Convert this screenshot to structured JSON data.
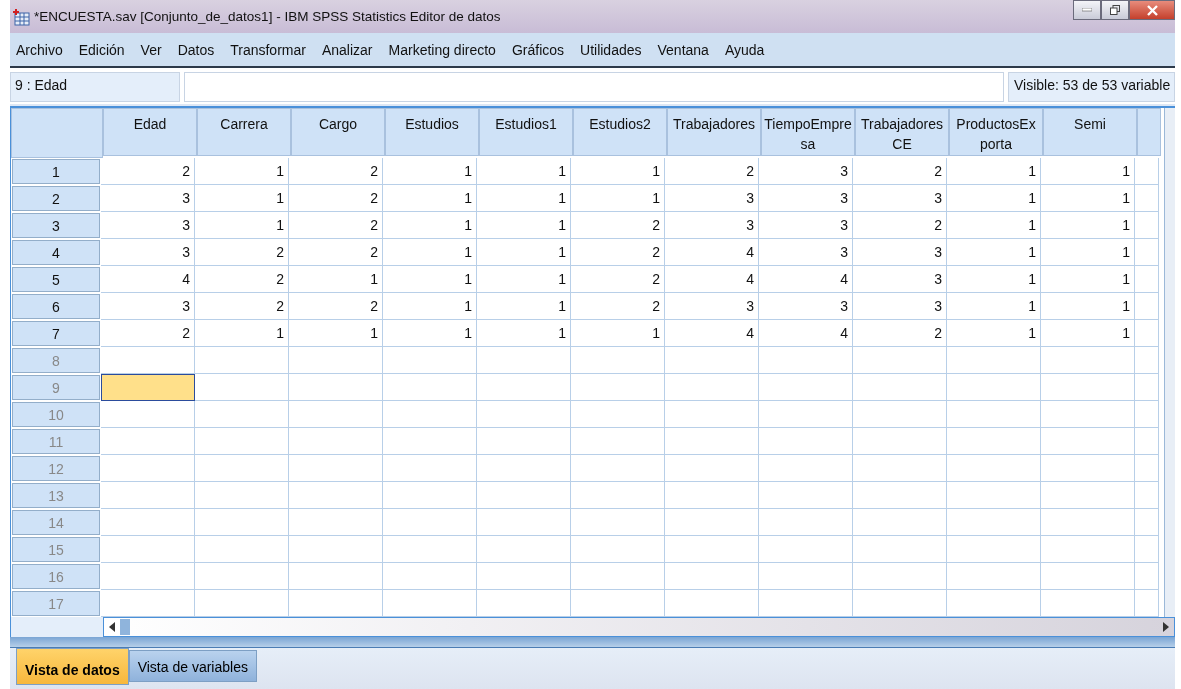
{
  "window": {
    "title": "*ENCUESTA.sav [Conjunto_de_datos1] - IBM SPSS Statistics Editor de datos"
  },
  "menu": [
    "Archivo",
    "Edición",
    "Ver",
    "Datos",
    "Transformar",
    "Analizar",
    "Marketing directo",
    "Gráficos",
    "Utilidades",
    "Ventana",
    "Ayuda"
  ],
  "cell_bar": {
    "reference": "9 : Edad",
    "visible": "Visible: 53 de 53 variable"
  },
  "table": {
    "columns": [
      "Edad",
      "Carrera",
      "Cargo",
      "Estudios",
      "Estudios1",
      "Estudios2",
      "Trabajadores",
      "TiempoEmpre\nsa",
      "Trabajadores\nCE",
      "ProductosEx\nporta",
      "Semi"
    ],
    "rows": [
      {
        "number": "1",
        "has_data": true,
        "selected": false,
        "cells": [
          "2",
          "1",
          "2",
          "1",
          "1",
          "1",
          "2",
          "3",
          "2",
          "1",
          "1"
        ]
      },
      {
        "number": "2",
        "has_data": true,
        "selected": false,
        "cells": [
          "3",
          "1",
          "2",
          "1",
          "1",
          "1",
          "3",
          "3",
          "3",
          "1",
          "1"
        ]
      },
      {
        "number": "3",
        "has_data": true,
        "selected": false,
        "cells": [
          "3",
          "1",
          "2",
          "1",
          "1",
          "2",
          "3",
          "3",
          "2",
          "1",
          "1"
        ]
      },
      {
        "number": "4",
        "has_data": true,
        "selected": false,
        "cells": [
          "3",
          "2",
          "2",
          "1",
          "1",
          "2",
          "4",
          "3",
          "3",
          "1",
          "1"
        ]
      },
      {
        "number": "5",
        "has_data": true,
        "selected": false,
        "cells": [
          "4",
          "2",
          "1",
          "1",
          "1",
          "2",
          "4",
          "4",
          "3",
          "1",
          "1"
        ]
      },
      {
        "number": "6",
        "has_data": true,
        "selected": false,
        "cells": [
          "3",
          "2",
          "2",
          "1",
          "1",
          "2",
          "3",
          "3",
          "3",
          "1",
          "1"
        ]
      },
      {
        "number": "7",
        "has_data": true,
        "selected": false,
        "cells": [
          "2",
          "1",
          "1",
          "1",
          "1",
          "1",
          "4",
          "4",
          "2",
          "1",
          "1"
        ]
      },
      {
        "number": "8",
        "has_data": false,
        "selected": false
      },
      {
        "number": "9",
        "has_data": false,
        "selected": true
      },
      {
        "number": "10",
        "has_data": false,
        "selected": false
      },
      {
        "number": "11",
        "has_data": false,
        "selected": false
      },
      {
        "number": "12",
        "has_data": false,
        "selected": false
      },
      {
        "number": "13",
        "has_data": false,
        "selected": false
      },
      {
        "number": "14",
        "has_data": false,
        "selected": false
      },
      {
        "number": "15",
        "has_data": false,
        "selected": false
      },
      {
        "number": "16",
        "has_data": false,
        "selected": false
      },
      {
        "number": "17",
        "has_data": false,
        "selected": false
      }
    ]
  },
  "tabs": [
    {
      "label": "Vista de datos",
      "selected": true
    },
    {
      "label": "Vista de variables",
      "selected": false
    }
  ]
}
